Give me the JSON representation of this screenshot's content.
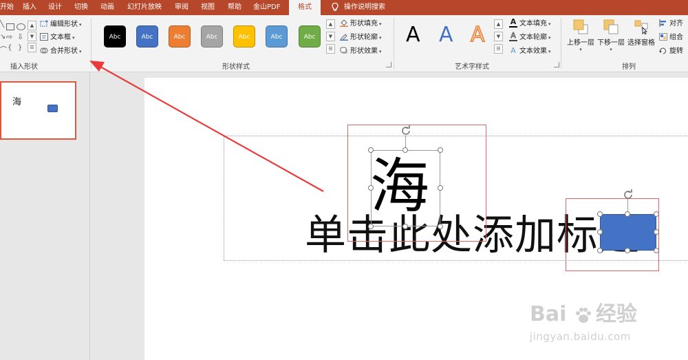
{
  "tabs": [
    {
      "label": "开始",
      "active": false
    },
    {
      "label": "插入",
      "active": false
    },
    {
      "label": "设计",
      "active": false
    },
    {
      "label": "切换",
      "active": false
    },
    {
      "label": "动画",
      "active": false
    },
    {
      "label": "幻灯片放映",
      "active": false
    },
    {
      "label": "审阅",
      "active": false
    },
    {
      "label": "视图",
      "active": false
    },
    {
      "label": "帮助",
      "active": false
    },
    {
      "label": "金山PDF",
      "active": false
    },
    {
      "label": "格式",
      "active": true
    }
  ],
  "tell_me": "操作说明搜索",
  "groups": {
    "insert_shapes": {
      "label": "插入形状",
      "edit_shape": "编辑形状",
      "text_box": "文本框",
      "merge_shapes": "合并形状"
    },
    "shape_styles": {
      "label": "形状样式",
      "presets": [
        {
          "text": "Abc",
          "color": "#000000"
        },
        {
          "text": "Abc",
          "color": "#4472c4"
        },
        {
          "text": "Abc",
          "color": "#ed7d31"
        },
        {
          "text": "Abc",
          "color": "#a5a5a5"
        },
        {
          "text": "Abc",
          "color": "#ffc000"
        },
        {
          "text": "Abc",
          "color": "#5b9bd5"
        },
        {
          "text": "Abc",
          "color": "#70ad47"
        }
      ],
      "fill": "形状填充",
      "outline": "形状轮廓",
      "effects": "形状效果"
    },
    "wordart_styles": {
      "label": "艺术字样式",
      "letters": [
        "A",
        "A",
        "A"
      ],
      "text_fill": "文本填充",
      "text_outline": "文本轮廓",
      "text_effects": "文本效果"
    },
    "arrange": {
      "label": "排列",
      "bring_forward": "上移一层",
      "send_backward": "下移一层",
      "selection_pane": "选择窗格",
      "align": "对齐",
      "group": "组合",
      "rotate": "旋转"
    }
  },
  "thumbnail": {
    "char": "海"
  },
  "slide": {
    "title_placeholder": "单击此处添加标题",
    "char": "海"
  },
  "watermark": {
    "brand": "Bai",
    "brand_cn": "经验",
    "url": "jingyan.baidu.com"
  },
  "colors": {
    "accent": "#b7472a",
    "selection": "#e06666",
    "shape_fill": "#4472c4",
    "annotation_arrow": "#ec3a3a"
  }
}
